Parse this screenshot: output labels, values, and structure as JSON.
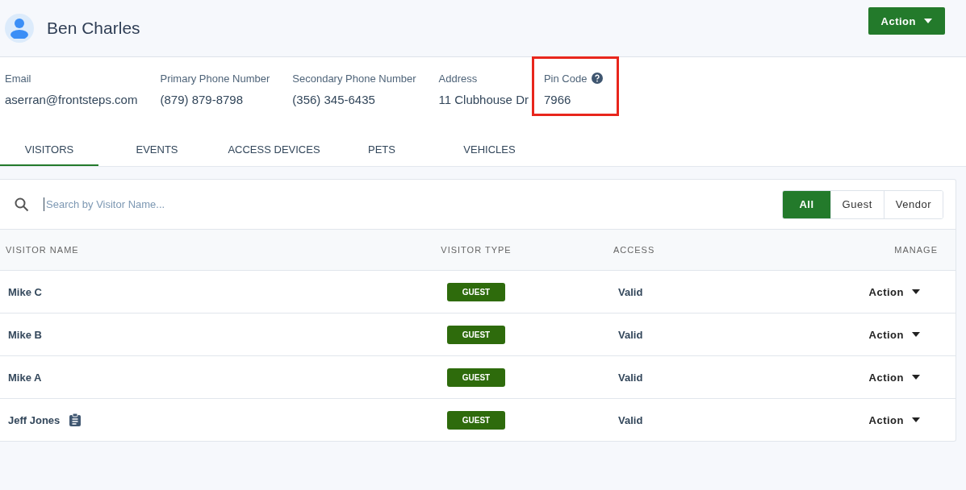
{
  "header": {
    "name": "Ben Charles",
    "action": "Action"
  },
  "fields": [
    {
      "label": "Email",
      "value": "aserran@frontsteps.com",
      "help": false,
      "highlighted": false
    },
    {
      "label": "Primary Phone Number",
      "value": "(879) 879-8798",
      "help": false,
      "highlighted": false
    },
    {
      "label": "Secondary Phone Number",
      "value": "(356) 345-6435",
      "help": false,
      "highlighted": false
    },
    {
      "label": "Address",
      "value": "11 Clubhouse Dr",
      "help": false,
      "highlighted": false
    },
    {
      "label": "Pin Code",
      "value": "7966",
      "help": true,
      "highlighted": true
    }
  ],
  "tabs": [
    {
      "label": "VISITORS",
      "selected": true
    },
    {
      "label": "EVENTS",
      "selected": false
    },
    {
      "label": "ACCESS DEVICES",
      "selected": false
    },
    {
      "label": "PETS",
      "selected": false
    },
    {
      "label": "VEHICLES",
      "selected": false
    }
  ],
  "search": {
    "placeholder": "Search by Visitor Name..."
  },
  "filters": [
    {
      "label": "All",
      "selected": true
    },
    {
      "label": "Guest",
      "selected": false
    },
    {
      "label": "Vendor",
      "selected": false
    }
  ],
  "table": {
    "columns": [
      "VISITOR NAME",
      "VISITOR TYPE",
      "ACCESS",
      "MANAGE"
    ],
    "rows": [
      {
        "name": "Mike C",
        "note": false,
        "type": "GUEST",
        "access": "Valid",
        "action": "Action"
      },
      {
        "name": "Mike B",
        "note": false,
        "type": "GUEST",
        "access": "Valid",
        "action": "Action"
      },
      {
        "name": "Mike A",
        "note": false,
        "type": "GUEST",
        "access": "Valid",
        "action": "Action"
      },
      {
        "name": "Jeff Jones",
        "note": true,
        "type": "GUEST",
        "access": "Valid",
        "action": "Action"
      }
    ]
  }
}
